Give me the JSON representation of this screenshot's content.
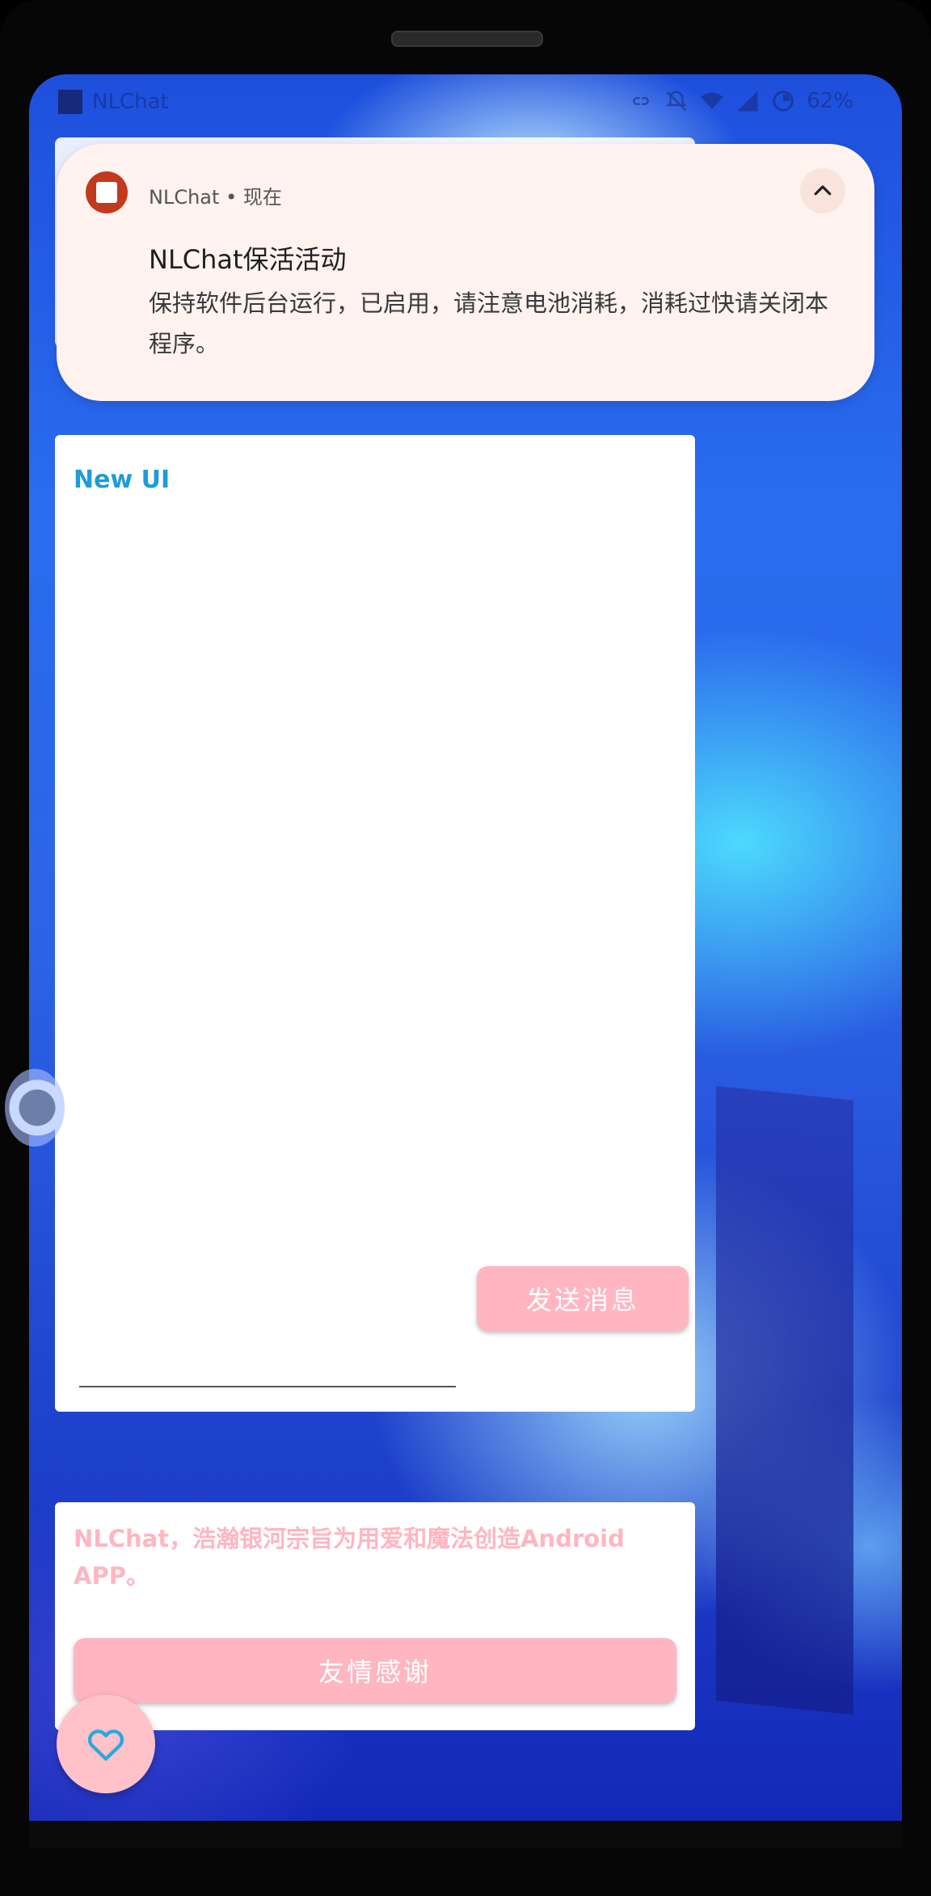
{
  "status_bar": {
    "app_name": "NLChat",
    "battery": "62%",
    "icons": [
      "link-icon",
      "mute-icon",
      "wifi-icon",
      "signal-icon",
      "battery-icon"
    ]
  },
  "notification": {
    "app": "NLChat",
    "separator": "•",
    "time": "现在",
    "title": "NLChat保活活动",
    "body": "保持软件后台运行，已启用，请注意电池消耗，消耗过快请关闭本程序。",
    "collapse_icon": "chevron-up-icon"
  },
  "main_card": {
    "title": "New UI",
    "send_label": "发送消息",
    "message_value": ""
  },
  "about_card": {
    "text": "NLChat，浩瀚银河宗旨为用爱和魔法创造Android APP。",
    "thanks_label": "友情感谢"
  },
  "fab": {
    "icon": "heart-icon"
  },
  "colors": {
    "accent_pink": "#ffb6c1",
    "title_blue": "#1e9bd9",
    "notification_bg": "#fff2ef",
    "app_icon_red": "#c23a1e"
  }
}
